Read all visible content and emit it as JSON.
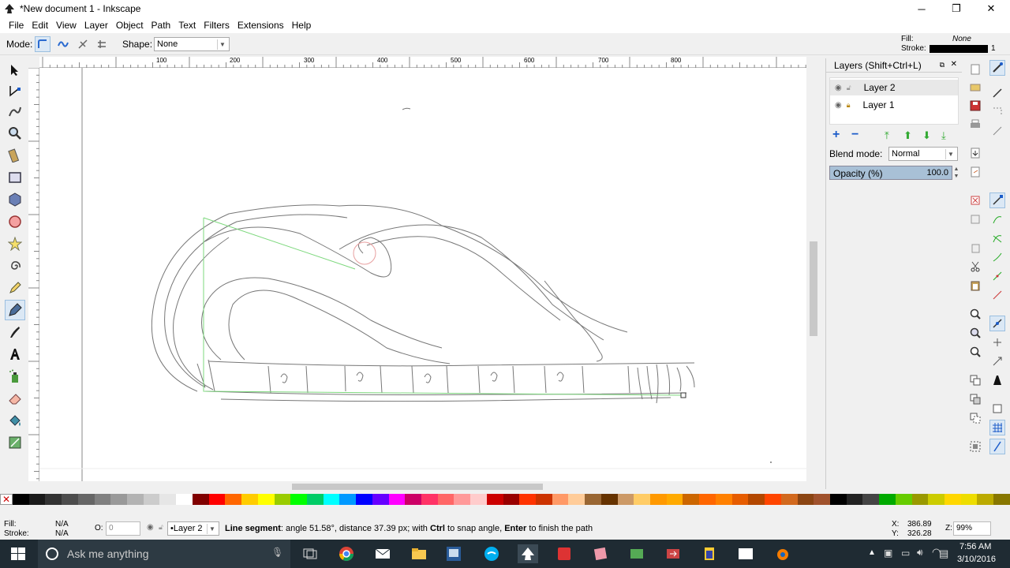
{
  "window": {
    "title": "*New document 1 - Inkscape",
    "minimize": "─",
    "restore": "❐",
    "close": "✕"
  },
  "menu": [
    "File",
    "Edit",
    "View",
    "Layer",
    "Object",
    "Path",
    "Text",
    "Filters",
    "Extensions",
    "Help"
  ],
  "tool_controls": {
    "mode_label": "Mode:",
    "shape_label": "Shape:",
    "shape_value": "None"
  },
  "style_indicator": {
    "fill_label": "Fill:",
    "fill_value": "None",
    "stroke_label": "Stroke:",
    "stroke_width": "1",
    "stroke_color": "#000000"
  },
  "hruler_ticks": [
    "100",
    "200",
    "300",
    "400",
    "500",
    "600",
    "700",
    "800"
  ],
  "layers_panel": {
    "title": "Layers (Shift+Ctrl+L)",
    "layers": [
      {
        "name": "Layer 2"
      },
      {
        "name": "Layer 1"
      }
    ],
    "blend_label": "Blend mode:",
    "blend_value": "Normal",
    "opacity_label": "Opacity (%)",
    "opacity_value": "100.0"
  },
  "palette": [
    "#000000",
    "#1a1a1a",
    "#333333",
    "#4d4d4d",
    "#666666",
    "#808080",
    "#999999",
    "#b3b3b3",
    "#cccccc",
    "#e6e6e6",
    "#ffffff",
    "#800000",
    "#ff0000",
    "#ff6600",
    "#ffcc00",
    "#ffff00",
    "#99cc00",
    "#00ff00",
    "#00cc66",
    "#00ffff",
    "#0099ff",
    "#0000ff",
    "#6600ff",
    "#ff00ff",
    "#cc0066",
    "#ff3366",
    "#ff6666",
    "#ff9999",
    "#ffcccc",
    "#cc0000",
    "#990000",
    "#ff3300",
    "#cc3300",
    "#ff9966",
    "#ffcc99",
    "#996633",
    "#663300",
    "#cc9966",
    "#ffcc66",
    "#ff9900",
    "#ffaa00",
    "#cc6600",
    "#ff6600",
    "#ff8000",
    "#e65c00",
    "#b34700",
    "#ff4500",
    "#d2691e",
    "#8b4513",
    "#a0522d",
    "#000000",
    "#222222",
    "#444444",
    "#00aa00",
    "#66cc00",
    "#999900",
    "#cccc00",
    "#ffd700",
    "#eedd00",
    "#bbaa00",
    "#887700"
  ],
  "status": {
    "fill_label": "Fill:",
    "fill_value": "N/A",
    "stroke_label": "Stroke:",
    "stroke_value": "N/A",
    "opacity_label": "O:",
    "opacity_value": "0",
    "layer_value": "•Layer 2",
    "message_bold1": "Line segment",
    "message_text1": ": angle 51.58°, distance 37.39 px; with ",
    "message_bold2": "Ctrl",
    "message_text2": " to snap angle, ",
    "message_bold3": "Enter",
    "message_text3": " to finish the path",
    "x_label": "X:",
    "x_value": "386.89",
    "y_label": "Y:",
    "y_value": "326.28",
    "zoom_label": "Z:",
    "zoom_value": "99%"
  },
  "taskbar": {
    "search_placeholder": "Ask me anything",
    "time": "7:56 AM",
    "date": "3/10/2016"
  }
}
